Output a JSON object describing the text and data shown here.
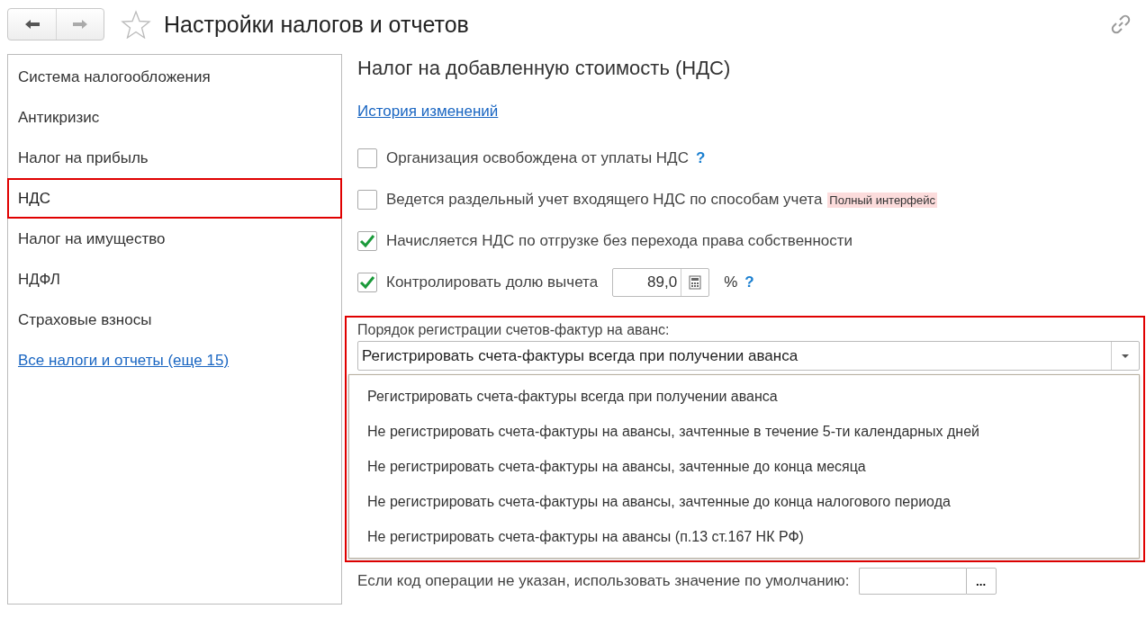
{
  "window": {
    "title": "Настройки налогов и отчетов",
    "favorite": false
  },
  "sidebar": {
    "items": [
      {
        "label": "Система налогообложения",
        "selected": false,
        "kind": "item"
      },
      {
        "label": "Антикризис",
        "selected": false,
        "kind": "item"
      },
      {
        "label": "Налог на прибыль",
        "selected": false,
        "kind": "item"
      },
      {
        "label": "НДС",
        "selected": true,
        "kind": "item"
      },
      {
        "label": "Налог на имущество",
        "selected": false,
        "kind": "item"
      },
      {
        "label": "НДФЛ",
        "selected": false,
        "kind": "item"
      },
      {
        "label": "Страховые взносы",
        "selected": false,
        "kind": "item"
      },
      {
        "label": "Все налоги и отчеты (еще 15)",
        "selected": false,
        "kind": "link"
      }
    ]
  },
  "section": {
    "title": "Налог на добавленную стоимость (НДС)",
    "history_link": "История изменений",
    "options": [
      {
        "label": "Организация освобождена от уплаты НДС",
        "checked": false,
        "help": "?"
      },
      {
        "label": "Ведется раздельный учет входящего НДС по способам учета",
        "checked": false,
        "tag": "Полный интерфейс"
      },
      {
        "label": "Начисляется НДС по отгрузке без перехода права собственности",
        "checked": true
      },
      {
        "label": "Контролировать долю вычета",
        "checked": true,
        "value": "89,0",
        "unit": "%",
        "help": "?"
      }
    ],
    "advance_invoices": {
      "label": "Порядок регистрации счетов-фактур на аванс:",
      "value": "Регистрировать счета-фактуры всегда при получении аванса",
      "options": [
        "Регистрировать счета-фактуры всегда при получении аванса",
        "Не регистрировать счета-фактуры на авансы, зачтенные в течение 5-ти календарных дней",
        "Не регистрировать счета-фактуры на авансы, зачтенные до конца месяца",
        "Не регистрировать счета-фактуры на авансы, зачтенные до конца налогового периода",
        "Не регистрировать счета-фактуры на авансы (п.13 ст.167 НК РФ)"
      ]
    },
    "default_code": {
      "label": "Если код операции не указан, использовать значение по умолчанию:",
      "button": "..."
    }
  }
}
